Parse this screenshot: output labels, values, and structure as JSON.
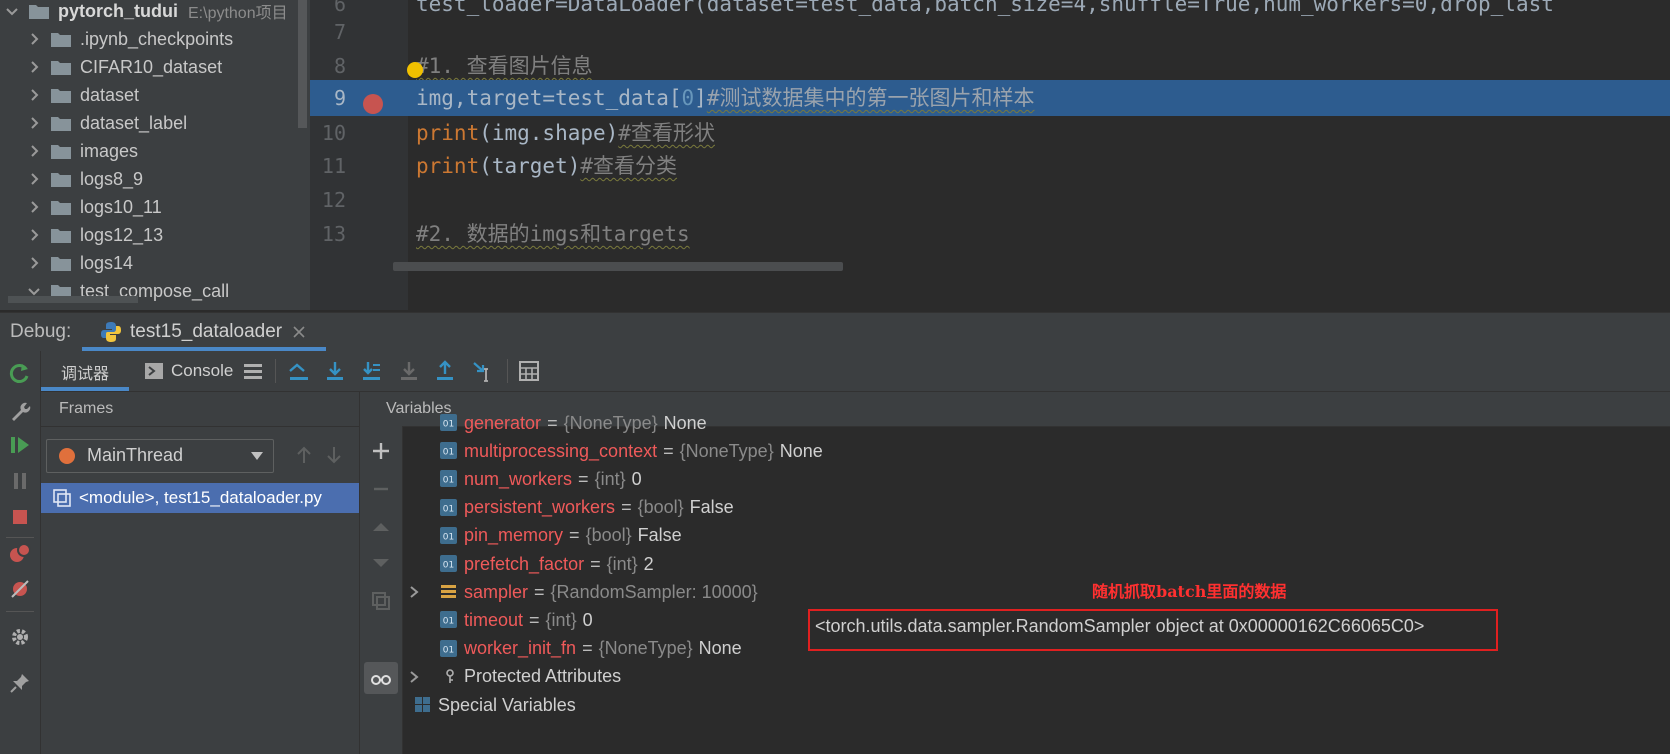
{
  "project": {
    "root_name": "pytorch_tudui",
    "root_path": "E:\\python项目",
    "items": [
      {
        "label": ".ipynb_checkpoints"
      },
      {
        "label": "CIFAR10_dataset"
      },
      {
        "label": "dataset"
      },
      {
        "label": "dataset_label"
      },
      {
        "label": "images"
      },
      {
        "label": "logs8_9"
      },
      {
        "label": "logs10_11"
      },
      {
        "label": "logs12_13"
      },
      {
        "label": "logs14"
      },
      {
        "label": "test_compose_call"
      }
    ]
  },
  "editor": {
    "lines": [
      {
        "num": "6",
        "code": "test_loader=DataLoader(dataset=test_data,batch_size=4,shuffle=True,num_workers=0,drop_last"
      },
      {
        "num": "7",
        "code": ""
      },
      {
        "num": "8",
        "comment": "#1. 查看图片信息"
      },
      {
        "num": "9",
        "code": "img,target=test_data[",
        "num_lit": "0",
        "code_end": "]",
        "comment": "#测试数据集中的第一张图片和样本"
      },
      {
        "num": "10",
        "kw": "print",
        "code": "(img.shape)",
        "comment": "#查看形状"
      },
      {
        "num": "11",
        "kw": "print",
        "code": "(target)",
        "comment": "#查看分类"
      },
      {
        "num": "12",
        "code": ""
      },
      {
        "num": "13",
        "comment": "#2. 数据的imgs和targets"
      }
    ]
  },
  "debug": {
    "label": "Debug:",
    "tab_label": "test15_dataloader",
    "tabs": {
      "debugger": "调试器",
      "console": "Console"
    }
  },
  "frames": {
    "title": "Frames",
    "thread": "MainThread",
    "frame": "<module>, test15_dataloader.py"
  },
  "variables": {
    "title": "Variables",
    "rows": [
      {
        "name": "generator",
        "type": "{NoneType}",
        "value": "None"
      },
      {
        "name": "multiprocessing_context",
        "type": "{NoneType}",
        "value": "None"
      },
      {
        "name": "num_workers",
        "type": "{int}",
        "value": "0"
      },
      {
        "name": "persistent_workers",
        "type": "{bool}",
        "value": "False"
      },
      {
        "name": "pin_memory",
        "type": "{bool}",
        "value": "False"
      },
      {
        "name": "prefetch_factor",
        "type": "{int}",
        "value": "2"
      },
      {
        "name": "sampler",
        "type": "{RandomSampler: 10000}",
        "value": "<torch.utils.data.sampler.RandomSampler object at 0x00000162C66065C0>"
      },
      {
        "name": "timeout",
        "type": "{int}",
        "value": "0"
      },
      {
        "name": "worker_init_fn",
        "type": "{NoneType}",
        "value": "None"
      }
    ],
    "protected": "Protected Attributes",
    "special": "Special Variables"
  },
  "annotation": "随机抓取batch里面的数据"
}
